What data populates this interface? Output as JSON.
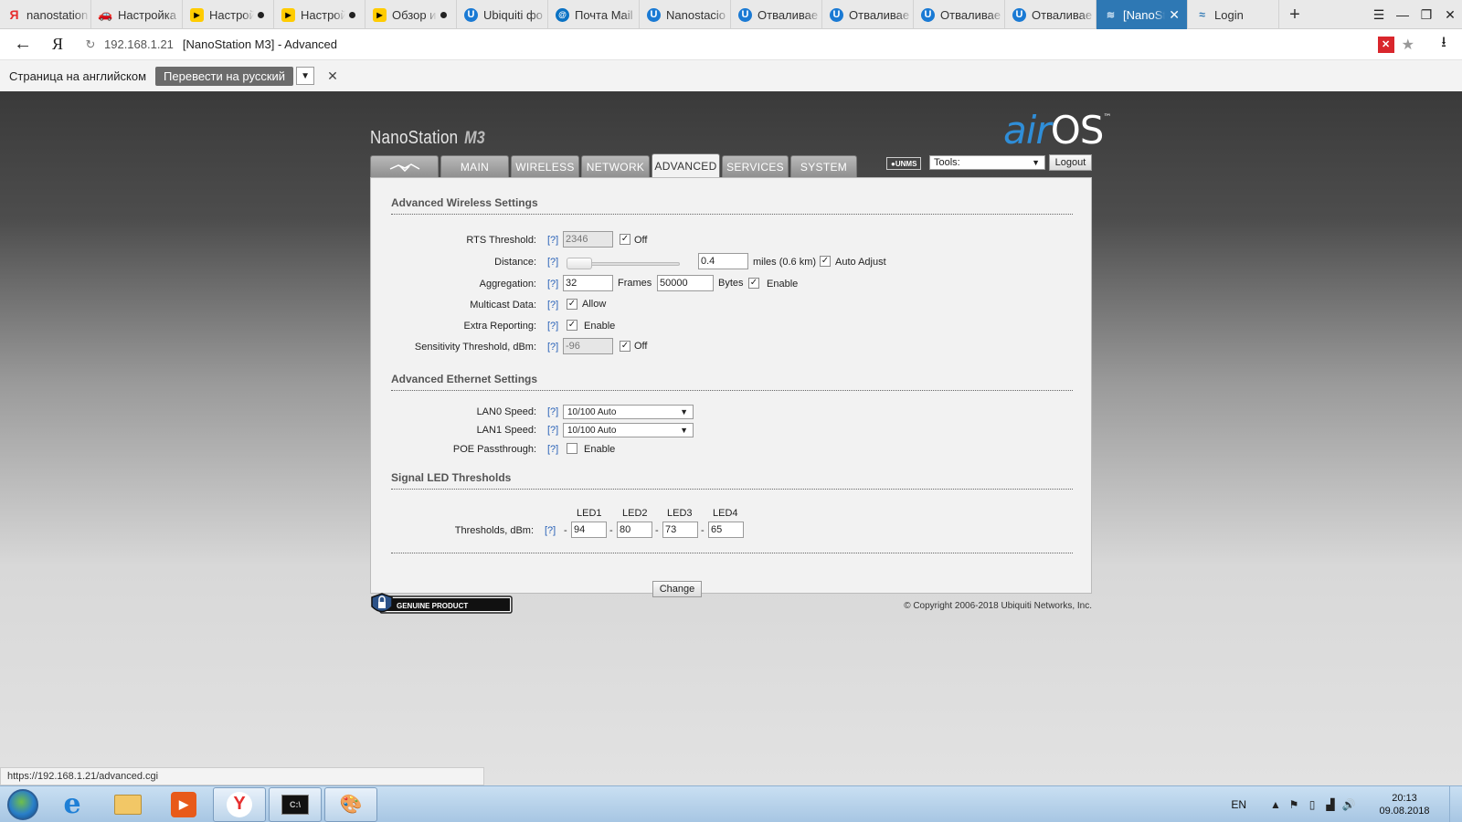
{
  "browser": {
    "tabs": [
      {
        "favicon": "yandex-icon",
        "title": "nanostation",
        "audio": false,
        "active": false
      },
      {
        "favicon": "car-icon",
        "title": "Настройка",
        "audio": false,
        "active": false
      },
      {
        "favicon": "youtube-icon",
        "title": "Настрой",
        "audio": true,
        "active": false
      },
      {
        "favicon": "youtube-icon",
        "title": "Настрой",
        "audio": true,
        "active": false
      },
      {
        "favicon": "youtube-icon",
        "title": "Обзор и",
        "audio": true,
        "active": false
      },
      {
        "favicon": "ubiquiti-icon",
        "title": "Ubiquiti фо",
        "audio": false,
        "active": false
      },
      {
        "favicon": "mail-icon",
        "title": "Почта Mail",
        "audio": false,
        "active": false
      },
      {
        "favicon": "ubiquiti-icon",
        "title": "Nanostacio",
        "audio": false,
        "active": false
      },
      {
        "favicon": "ubiquiti-icon",
        "title": "Отваливае",
        "audio": false,
        "active": false
      },
      {
        "favicon": "ubiquiti-icon",
        "title": "Отваливае",
        "audio": false,
        "active": false
      },
      {
        "favicon": "ubiquiti-icon",
        "title": "Отваливае",
        "audio": false,
        "active": false
      },
      {
        "favicon": "ubiquiti-icon",
        "title": "Отваливае",
        "audio": false,
        "active": false
      },
      {
        "favicon": "wireless-icon",
        "title": "[NanoSt",
        "audio": false,
        "active": true
      },
      {
        "favicon": "rss-icon",
        "title": "Login",
        "audio": false,
        "active": false
      }
    ],
    "new_tab_glyph": "+",
    "window_controls": {
      "menu": "☰",
      "minimize": "—",
      "restore": "❐",
      "close": "✕"
    },
    "address": {
      "host": "192.168.1.21",
      "title": "[NanoStation M3] - Advanced"
    },
    "translate_bar": {
      "text": "Страница на английском",
      "button": "Перевести на русский",
      "close_glyph": "✕"
    },
    "status_url": "https://192.168.1.21/advanced.cgi"
  },
  "airos": {
    "brand": "NanoStation",
    "model": "M3",
    "logo_air": "air",
    "logo_os": "OS",
    "logo_tm": "™",
    "nav_tabs": [
      "MAIN",
      "WIRELESS",
      "NETWORK",
      "ADVANCED",
      "SERVICES",
      "SYSTEM"
    ],
    "active_tab": "ADVANCED",
    "unms_label": "UNMS",
    "tools_select": "Tools:",
    "logout": "Logout",
    "help_link": "[?]",
    "sections": {
      "wireless": "Advanced Wireless Settings",
      "ethernet": "Advanced Ethernet Settings",
      "led": "Signal LED Thresholds"
    },
    "wireless": {
      "rts": {
        "label": "RTS Threshold:",
        "value": "2346",
        "checkbox_label": "Off",
        "checked": true
      },
      "distance": {
        "label": "Distance:",
        "value": "0.4",
        "unit": "miles (0.6 km)",
        "checkbox_label": "Auto Adjust",
        "checked": true
      },
      "aggregation": {
        "label": "Aggregation:",
        "frames": "32",
        "frames_unit": "Frames",
        "bytes": "50000",
        "bytes_unit": "Bytes",
        "checkbox_label": "Enable",
        "checked": true
      },
      "multicast": {
        "label": "Multicast Data:",
        "checkbox_label": "Allow",
        "checked": true
      },
      "extra_reporting": {
        "label": "Extra Reporting:",
        "checkbox_label": "Enable",
        "checked": true
      },
      "sensitivity": {
        "label": "Sensitivity Threshold, dBm:",
        "value": "-96",
        "checkbox_label": "Off",
        "checked": true
      }
    },
    "ethernet": {
      "lan0": {
        "label": "LAN0 Speed:",
        "value": "10/100 Auto"
      },
      "lan1": {
        "label": "LAN1 Speed:",
        "value": "10/100 Auto"
      },
      "poe": {
        "label": "POE Passthrough:",
        "checkbox_label": "Enable",
        "checked": false
      }
    },
    "led": {
      "label": "Thresholds, dBm:",
      "headers": [
        "LED1",
        "LED2",
        "LED3",
        "LED4"
      ],
      "values": [
        "94",
        "80",
        "73",
        "65"
      ],
      "minus": "-"
    },
    "change_button": "Change",
    "genuine_product": "GENUINE PRODUCT",
    "copyright": "© Copyright 2006-2018 Ubiquiti Networks, Inc."
  },
  "taskbar": {
    "apps": [
      "internet-explorer-icon",
      "file-explorer-icon",
      "media-player-icon",
      "yandex-browser-icon",
      "command-prompt-icon",
      "paint-icon"
    ],
    "language": "EN",
    "time": "20:13",
    "date": "09.08.2018"
  }
}
